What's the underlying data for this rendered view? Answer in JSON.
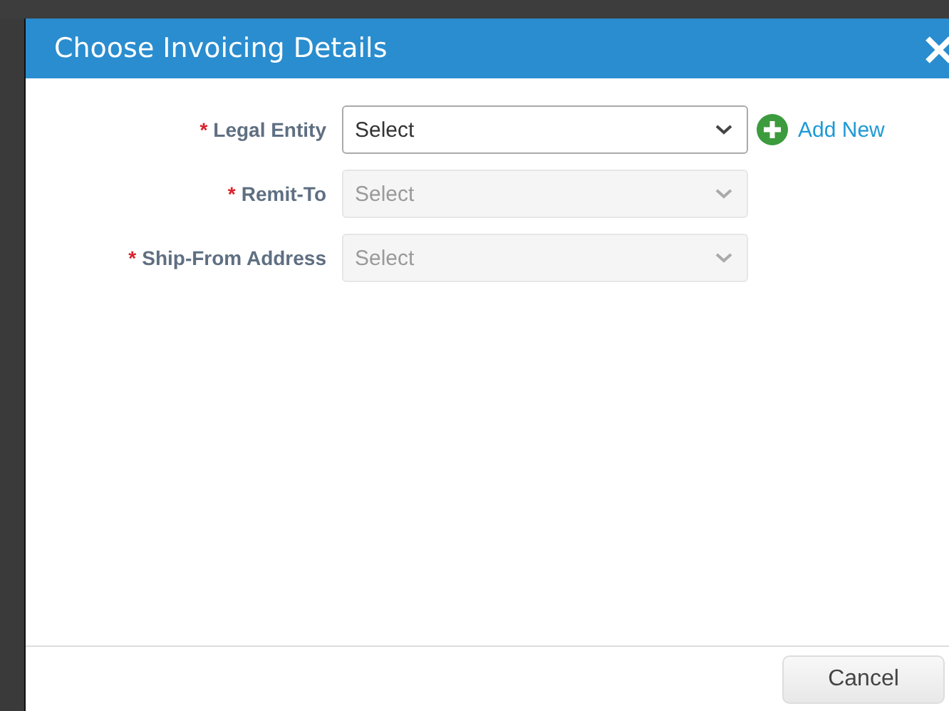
{
  "dialog": {
    "title": "Choose Invoicing Details"
  },
  "fields": [
    {
      "label": "Legal Entity",
      "required": "*",
      "value": "Select",
      "disabled": false,
      "add_new": "Add New"
    },
    {
      "label": "Remit-To",
      "required": "*",
      "value": "Select",
      "disabled": true
    },
    {
      "label": "Ship-From Address",
      "required": "*",
      "value": "Select",
      "disabled": true
    }
  ],
  "buttons": [
    {
      "label": "Cancel"
    }
  ]
}
